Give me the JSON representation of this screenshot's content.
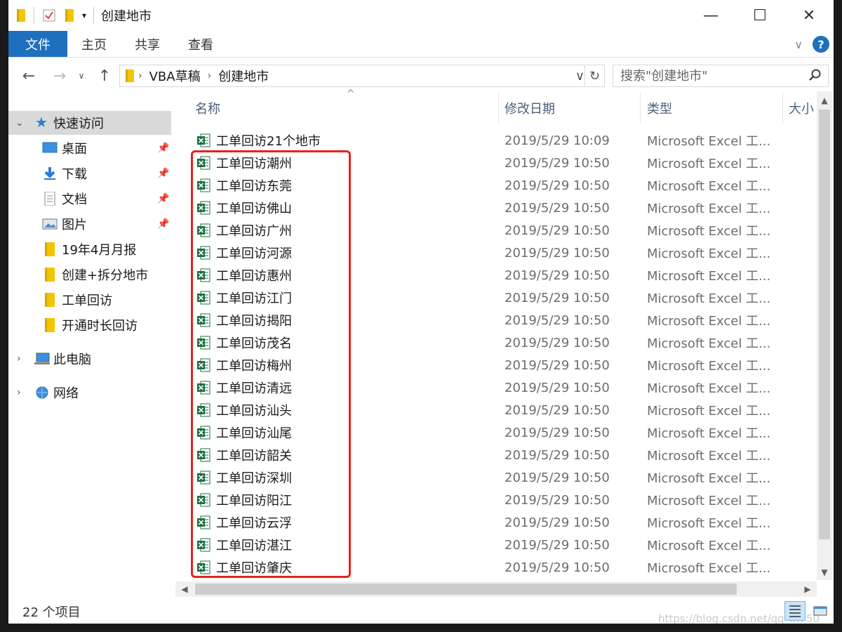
{
  "window": {
    "title": "创建地市",
    "minimize": "—",
    "maximize": "☐",
    "close": "✕"
  },
  "ribbon": {
    "tabs": [
      "文件",
      "主页",
      "共享",
      "查看"
    ],
    "expand": "∨",
    "help": "?"
  },
  "nav": {
    "back": "←",
    "forward": "→",
    "recent": "∨",
    "up": "↑",
    "breadcrumb": [
      "VBA草稿",
      "创建地市"
    ],
    "dropdown": "∨",
    "refresh": "↻",
    "search_placeholder": "搜索\"创建地市\"",
    "search_icon": "search-icon"
  },
  "sidebar": {
    "quick_access": "快速访问",
    "pinned": [
      {
        "label": "桌面",
        "icon": "desktop-icon"
      },
      {
        "label": "下载",
        "icon": "download-icon"
      },
      {
        "label": "文档",
        "icon": "document-icon"
      },
      {
        "label": "图片",
        "icon": "pictures-icon"
      }
    ],
    "folders": [
      "19年4月月报",
      "创建+拆分地市",
      "工单回访",
      "开通时长回访"
    ],
    "this_pc": "此电脑",
    "network": "网络"
  },
  "columns": {
    "name": "名称",
    "date": "修改日期",
    "type": "类型",
    "size": "大小"
  },
  "files": [
    {
      "name": "工单回访21个地市",
      "date": "2019/5/29 10:09",
      "type": "Microsoft Excel 工..."
    },
    {
      "name": "工单回访潮州",
      "date": "2019/5/29 10:50",
      "type": "Microsoft Excel 工..."
    },
    {
      "name": "工单回访东莞",
      "date": "2019/5/29 10:50",
      "type": "Microsoft Excel 工..."
    },
    {
      "name": "工单回访佛山",
      "date": "2019/5/29 10:50",
      "type": "Microsoft Excel 工..."
    },
    {
      "name": "工单回访广州",
      "date": "2019/5/29 10:50",
      "type": "Microsoft Excel 工..."
    },
    {
      "name": "工单回访河源",
      "date": "2019/5/29 10:50",
      "type": "Microsoft Excel 工..."
    },
    {
      "name": "工单回访惠州",
      "date": "2019/5/29 10:50",
      "type": "Microsoft Excel 工..."
    },
    {
      "name": "工单回访江门",
      "date": "2019/5/29 10:50",
      "type": "Microsoft Excel 工..."
    },
    {
      "name": "工单回访揭阳",
      "date": "2019/5/29 10:50",
      "type": "Microsoft Excel 工..."
    },
    {
      "name": "工单回访茂名",
      "date": "2019/5/29 10:50",
      "type": "Microsoft Excel 工..."
    },
    {
      "name": "工单回访梅州",
      "date": "2019/5/29 10:50",
      "type": "Microsoft Excel 工..."
    },
    {
      "name": "工单回访清远",
      "date": "2019/5/29 10:50",
      "type": "Microsoft Excel 工..."
    },
    {
      "name": "工单回访汕头",
      "date": "2019/5/29 10:50",
      "type": "Microsoft Excel 工..."
    },
    {
      "name": "工单回访汕尾",
      "date": "2019/5/29 10:50",
      "type": "Microsoft Excel 工..."
    },
    {
      "name": "工单回访韶关",
      "date": "2019/5/29 10:50",
      "type": "Microsoft Excel 工..."
    },
    {
      "name": "工单回访深圳",
      "date": "2019/5/29 10:50",
      "type": "Microsoft Excel 工..."
    },
    {
      "name": "工单回访阳江",
      "date": "2019/5/29 10:50",
      "type": "Microsoft Excel 工..."
    },
    {
      "name": "工单回访云浮",
      "date": "2019/5/29 10:50",
      "type": "Microsoft Excel 工..."
    },
    {
      "name": "工单回访湛江",
      "date": "2019/5/29 10:50",
      "type": "Microsoft Excel 工..."
    },
    {
      "name": "工单回访肇庆",
      "date": "2019/5/29 10:50",
      "type": "Microsoft Excel 工..."
    }
  ],
  "status": {
    "count": "22 个项目",
    "watermark": "https://blog.csdn.net/qq_...750"
  },
  "colors": {
    "accent": "#1f6fbf",
    "highlight_box": "#e8231e",
    "excel_green": "#1d6f42",
    "folder": "#f4c400"
  }
}
